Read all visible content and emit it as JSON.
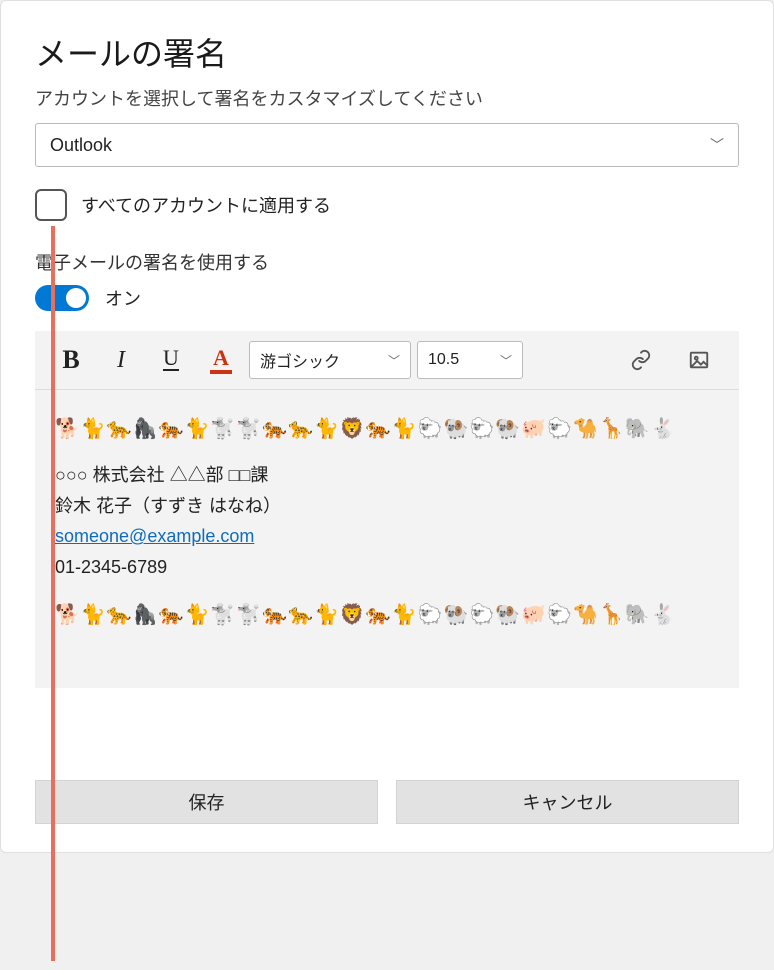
{
  "title": "メールの署名",
  "subtitle": "アカウントを選択して署名をカスタマイズしてください",
  "account_select": {
    "value": "Outlook"
  },
  "apply_all": {
    "checked": false,
    "label": "すべてのアカウントに適用する"
  },
  "use_signature": {
    "label": "電子メールの署名を使用する",
    "state_label": "オン",
    "on": true
  },
  "toolbar": {
    "font_family": "游ゴシック",
    "font_size": "10.5",
    "icons": {
      "bold": "bold-icon",
      "italic": "italic-icon",
      "underline": "underline-icon",
      "font_color": "font-color-icon",
      "link": "link-icon",
      "image": "image-icon"
    }
  },
  "signature": {
    "decor_line": "🐕🐈🐆🦍🐅🐈🐩🐩🐅🐆🐈🦁🐅🐈🐑🐏🐑🐏🐖🐑🐪🦒🐘🐇",
    "line1": "○○○ 株式会社 △△部 □□課",
    "line2": "鈴木 花子（すずき はなね）",
    "email": "someone@example.com",
    "phone": "01-2345-6789"
  },
  "buttons": {
    "save": "保存",
    "cancel": "キャンセル"
  },
  "colors": {
    "accent": "#0078d4",
    "link": "#0f6cbd",
    "font_color_red": "#cc3311",
    "annotation": "#e86f5b"
  }
}
